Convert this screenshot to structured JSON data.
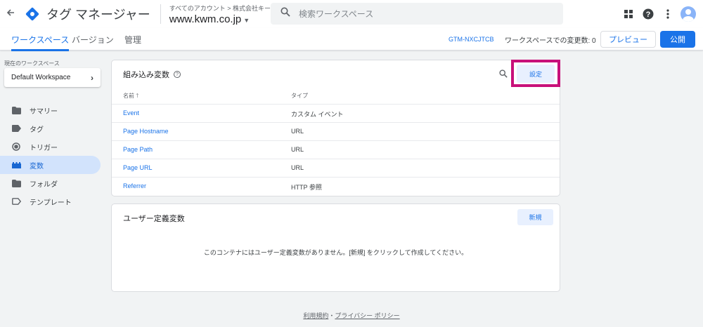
{
  "header": {
    "app_name": "タグ マネージャー",
    "account_path": "すべてのアカウント > 株式会社キーワードマ...",
    "container_name": "www.kwm.co.jp",
    "search_placeholder": "検索ワークスペース"
  },
  "tabs": [
    {
      "label": "ワークスペース",
      "active": true
    },
    {
      "label": "バージョン",
      "active": false
    },
    {
      "label": "管理",
      "active": false
    }
  ],
  "toolbar": {
    "container_id": "GTM-NXCJTCB",
    "changes_label": "ワークスペースでの変更数: 0",
    "preview_label": "プレビュー",
    "publish_label": "公開"
  },
  "sidebar": {
    "workspace_label": "現在のワークスペース",
    "workspace_name": "Default Workspace",
    "items": [
      {
        "label": "サマリー",
        "icon": "folder-icon"
      },
      {
        "label": "タグ",
        "icon": "tag-icon"
      },
      {
        "label": "トリガー",
        "icon": "trigger-icon"
      },
      {
        "label": "変数",
        "icon": "variables-icon",
        "active": true
      },
      {
        "label": "フォルダ",
        "icon": "folder-icon"
      },
      {
        "label": "テンプレート",
        "icon": "template-icon"
      }
    ]
  },
  "builtin": {
    "title": "組み込み変数",
    "settings_label": "設定",
    "col_name": "名前",
    "col_type": "タイプ",
    "rows": [
      {
        "name": "Event",
        "type": "カスタム イベント"
      },
      {
        "name": "Page Hostname",
        "type": "URL"
      },
      {
        "name": "Page Path",
        "type": "URL"
      },
      {
        "name": "Page URL",
        "type": "URL"
      },
      {
        "name": "Referrer",
        "type": "HTTP 参照"
      }
    ]
  },
  "user_defined": {
    "title": "ユーザー定義変数",
    "new_label": "新規",
    "empty_message": "このコンテナにはユーザー定義変数がありません。[新規] をクリックして作成してください。"
  },
  "footer": {
    "terms": "利用規約",
    "separator": "・",
    "privacy": "プライバシー ポリシー"
  },
  "colors": {
    "accent": "#1a73e8",
    "highlight": "#c8107a"
  }
}
